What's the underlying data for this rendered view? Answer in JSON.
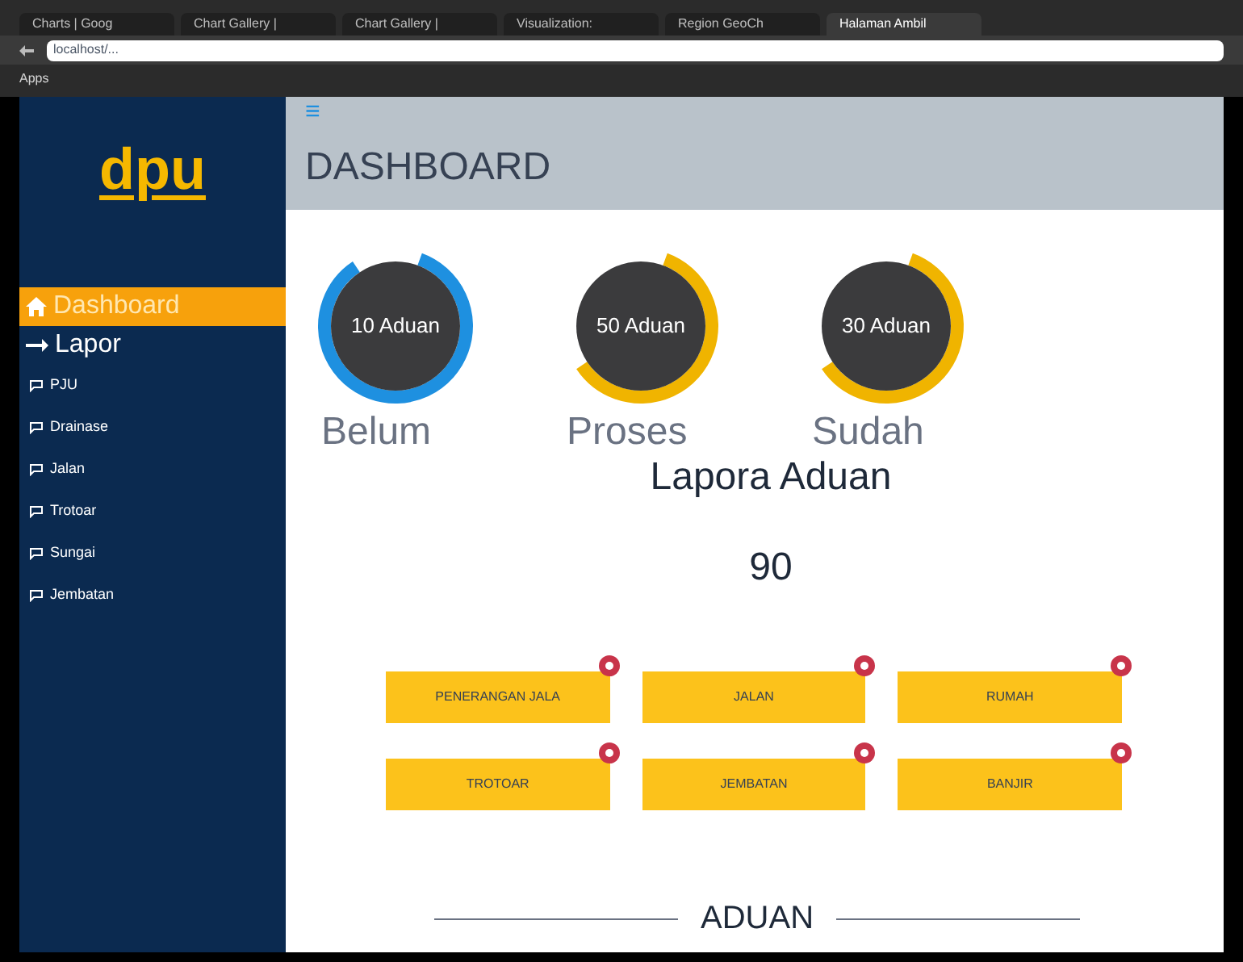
{
  "browser": {
    "tabs": [
      {
        "title": "Charts | Goog",
        "selected": false
      },
      {
        "title": "Chart Gallery |",
        "selected": false
      },
      {
        "title": "Chart Gallery |",
        "selected": false
      },
      {
        "title": "Visualization:",
        "selected": false
      },
      {
        "title": "Region GeoCh",
        "selected": false
      },
      {
        "title": "Halaman Ambil",
        "selected": true
      }
    ],
    "address": "localhost/...",
    "bookmarks": [
      "Apps"
    ]
  },
  "sidebar": {
    "logo": "dpu",
    "items": [
      {
        "label": "Dashboard",
        "kind": "main",
        "selected": true
      },
      {
        "label": "Lapor",
        "kind": "main",
        "selected": false
      },
      {
        "label": "PJU",
        "kind": "sub",
        "selected": false
      },
      {
        "label": "Drainase",
        "kind": "sub",
        "selected": false
      },
      {
        "label": "Jalan",
        "kind": "sub",
        "selected": false
      },
      {
        "label": "Trotoar",
        "kind": "sub",
        "selected": false
      },
      {
        "label": "Sungai",
        "kind": "sub",
        "selected": false
      },
      {
        "label": "Jembatan",
        "kind": "sub",
        "selected": false
      }
    ]
  },
  "header": {
    "menu": "≡",
    "title": "DASHBOARD"
  },
  "stats": [
    {
      "value": "10 Aduan",
      "label": "Belum",
      "color": "#1e90e0"
    },
    {
      "value": "50 Aduan",
      "label": "Proses",
      "color": "#f0b400"
    },
    {
      "value": "30 Aduan",
      "label": "Sudah",
      "color": "#f0b400"
    }
  ],
  "summary": {
    "title": "Lapora Aduan",
    "total": "90"
  },
  "categories": [
    "PENERANGAN JALA",
    "JALAN",
    "RUMAH",
    "TROTOAR",
    "JEMBATAN",
    "BANJIR"
  ],
  "section_title": "ADUAN"
}
